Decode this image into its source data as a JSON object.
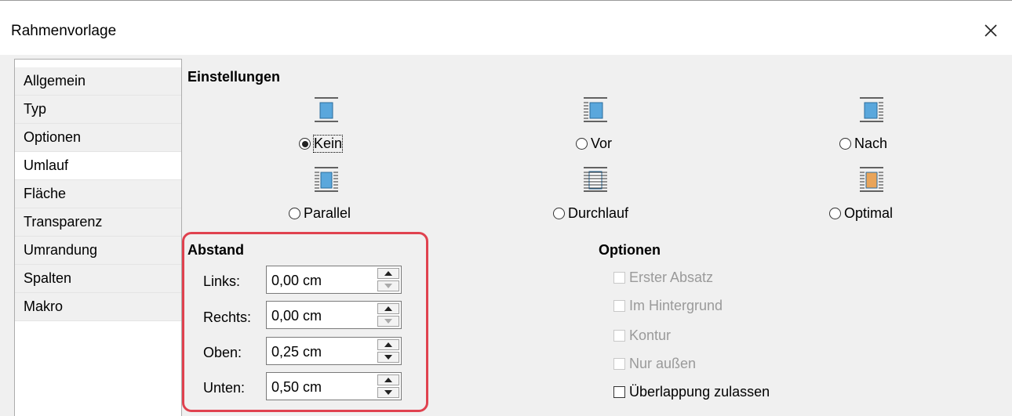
{
  "window": {
    "title": "Rahmenvorlage",
    "close_icon": "close-icon"
  },
  "sidebar": {
    "items": [
      {
        "label": "Allgemein"
      },
      {
        "label": "Typ"
      },
      {
        "label": "Optionen"
      },
      {
        "label": "Umlauf",
        "active": true
      },
      {
        "label": "Fläche"
      },
      {
        "label": "Transparenz"
      },
      {
        "label": "Umrandung"
      },
      {
        "label": "Spalten"
      },
      {
        "label": "Makro"
      }
    ]
  },
  "einstellungen": {
    "title": "Einstellungen",
    "options": [
      {
        "label": "Kein",
        "icon": "wrap-none-icon",
        "selected": true
      },
      {
        "label": "Vor",
        "icon": "wrap-before-icon",
        "selected": false
      },
      {
        "label": "Nach",
        "icon": "wrap-after-icon",
        "selected": false
      },
      {
        "label": "Parallel",
        "icon": "wrap-parallel-icon",
        "selected": false
      },
      {
        "label": "Durchlauf",
        "icon": "wrap-through-icon",
        "selected": false
      },
      {
        "label": "Optimal",
        "icon": "wrap-optimal-icon",
        "selected": false
      }
    ]
  },
  "abstand": {
    "title": "Abstand",
    "fields": [
      {
        "label": "Links:",
        "value": "0,00 cm"
      },
      {
        "label": "Rechts:",
        "value": "0,00 cm"
      },
      {
        "label": "Oben:",
        "value": "0,25 cm"
      },
      {
        "label": "Unten:",
        "value": "0,50 cm"
      }
    ]
  },
  "optionen": {
    "title": "Optionen",
    "checks": [
      {
        "label": "Erster Absatz",
        "enabled": false,
        "checked": false
      },
      {
        "label": "Im Hintergrund",
        "enabled": false,
        "checked": false
      },
      {
        "label": "Kontur",
        "enabled": false,
        "checked": false
      },
      {
        "label": "Nur außen",
        "enabled": false,
        "checked": false
      },
      {
        "label": "Überlappung zulassen",
        "enabled": true,
        "checked": false
      }
    ]
  },
  "colors": {
    "highlight": "#e0424f",
    "frame_fill": "#5aa7dc",
    "optimal_fill": "#e8a45a"
  }
}
